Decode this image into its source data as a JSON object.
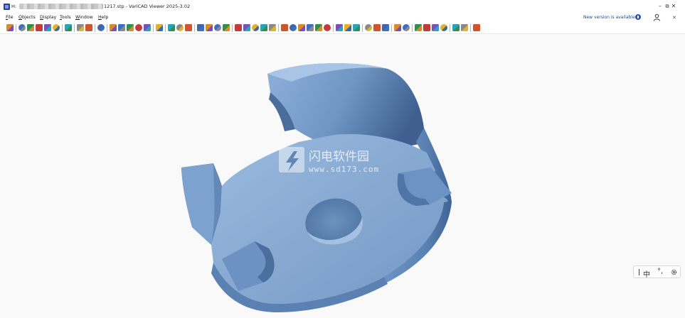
{
  "window": {
    "title_prefix": "H:",
    "title_suffix": "1217.stp - VariCAD Viewer 2025-3.02",
    "controls": {
      "minimize": "–",
      "restore": "⧉",
      "close": "✕"
    }
  },
  "menu": {
    "items": [
      "File",
      "Objects",
      "Display",
      "Tools",
      "Window",
      "Help"
    ]
  },
  "notice": {
    "text": "New version is available",
    "icon": "info-icon",
    "close": "✕"
  },
  "toolbar": {
    "icons": [
      "home-icon",
      "open-folder-icon",
      "save-icon",
      "save-as-icon",
      "export-icon",
      "print-preview-icon",
      "print-icon",
      "undo-icon",
      "redo-icon",
      "properties-icon",
      "measure-distance-icon",
      "measure-angle-icon",
      "measure-radius-icon",
      "measure-point-icon",
      "layers-icon",
      "explode-icon",
      "view-front-icon",
      "view-iso-icon",
      "rotate-icon",
      "pan-icon",
      "zoom-icon",
      "section-icon",
      "shade-icon",
      "wireframe-icon",
      "hidden-lines-icon",
      "color-icon",
      "transparency-icon",
      "lights-icon",
      "select-icon",
      "filter-icon",
      "check-icon",
      "heart-icon",
      "mass-icon",
      "hole-icon",
      "bom-icon",
      "dimension-icon",
      "ruler-icon",
      "screen-icon",
      "monitor-icon",
      "camera-icon",
      "zoom-all-icon",
      "zoom-window-icon",
      "zoom-in-icon",
      "zoom-out-icon",
      "zoom-previous-icon",
      "zoom-next-icon",
      "fit-icon",
      "export-image-icon",
      "picture-icon"
    ]
  },
  "ime": {
    "lang": "中",
    "punct": "°,",
    "gear_icon": "settings-icon"
  },
  "colors": {
    "model_face": "#85a8d0",
    "model_side": "#5d86b4",
    "model_dark": "#3d5f8c",
    "viewport_bg": "#f9f9f9"
  }
}
